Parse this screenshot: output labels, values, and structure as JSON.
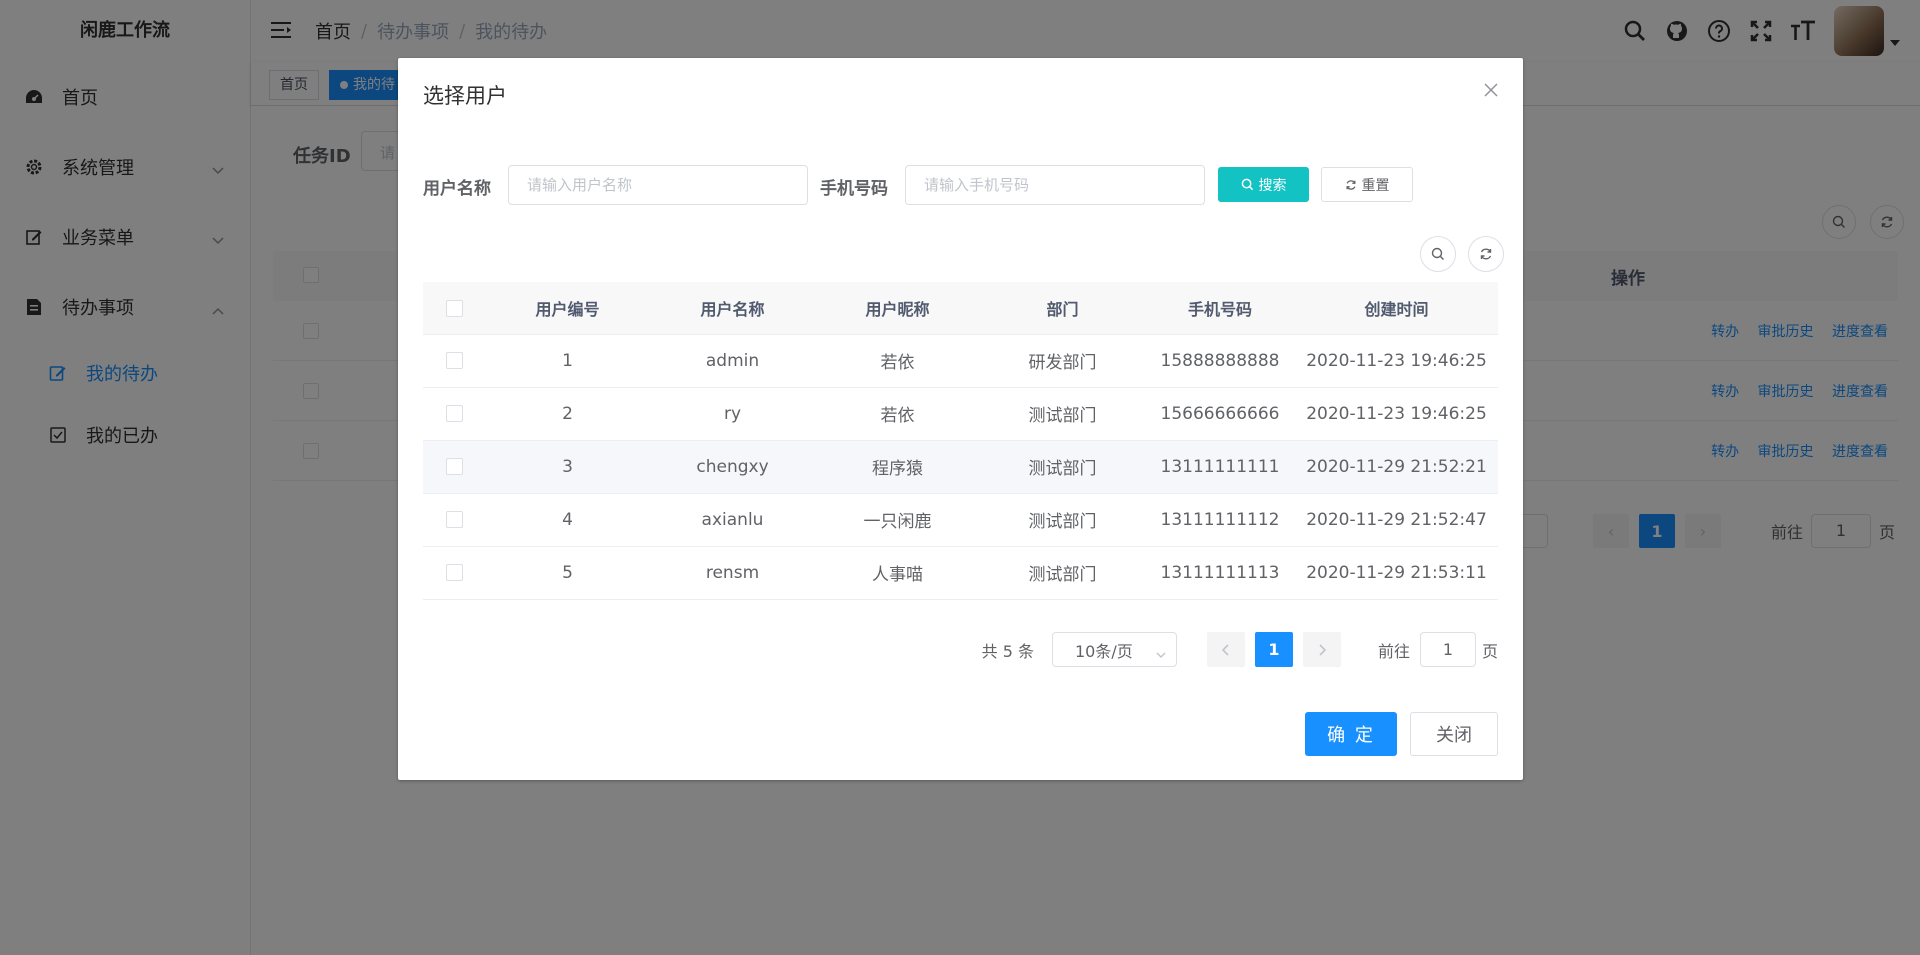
{
  "app": {
    "title": "闲鹿工作流"
  },
  "sidebar": {
    "items": [
      {
        "label": "首页",
        "icon": "dashboard-icon"
      },
      {
        "label": "系统管理",
        "icon": "gear-icon"
      },
      {
        "label": "业务菜单",
        "icon": "edit-icon"
      },
      {
        "label": "待办事项",
        "icon": "document-icon"
      }
    ],
    "subitems": [
      {
        "label": "我的待办",
        "icon": "edit-square-icon",
        "active": true
      },
      {
        "label": "我的已办",
        "icon": "checkbox-icon"
      }
    ]
  },
  "navbar": {
    "breadcrumb": [
      "首页",
      "待办事项",
      "我的待办"
    ],
    "separator": "/"
  },
  "tags": [
    {
      "label": "首页"
    },
    {
      "label": "我的待",
      "active": true
    }
  ],
  "background": {
    "filter_label": "任务ID",
    "filter_placeholder": "请",
    "actions_header": "操作",
    "row_actions": [
      "转办",
      "审批历史",
      "进度查看"
    ],
    "pager": {
      "size_suffix": "页",
      "current": "1",
      "goto": "前往",
      "jump_value": "1",
      "page_suffix": "页"
    }
  },
  "dialog": {
    "title": "选择用户",
    "form": {
      "username_label": "用户名称",
      "username_placeholder": "请输入用户名称",
      "phone_label": "手机号码",
      "phone_placeholder": "请输入手机号码",
      "search_label": "搜索",
      "reset_label": "重置"
    },
    "table": {
      "columns": [
        "用户编号",
        "用户名称",
        "用户昵称",
        "部门",
        "手机号码",
        "创建时间"
      ],
      "rows": [
        [
          "1",
          "admin",
          "若依",
          "研发部门",
          "15888888888",
          "2020-11-23 19:46:25"
        ],
        [
          "2",
          "ry",
          "若依",
          "测试部门",
          "15666666666",
          "2020-11-23 19:46:25"
        ],
        [
          "3",
          "chengxy",
          "程序猿",
          "测试部门",
          "13111111111",
          "2020-11-29 21:52:21"
        ],
        [
          "4",
          "axianlu",
          "一只闲鹿",
          "测试部门",
          "13111111112",
          "2020-11-29 21:52:47"
        ],
        [
          "5",
          "rensm",
          "人事喵",
          "测试部门",
          "13111111113",
          "2020-11-29 21:53:11"
        ]
      ]
    },
    "pager": {
      "total": "共 5 条",
      "page_size": "10条/页",
      "current": "1",
      "goto": "前往",
      "jump_value": "1",
      "page_suffix": "页"
    },
    "confirm_label": "确 定",
    "close_label": "关闭"
  },
  "colors": {
    "primary": "#1890ff",
    "search_button": "#13c2c2",
    "overlay": "rgba(0,0,0,0.5)"
  }
}
